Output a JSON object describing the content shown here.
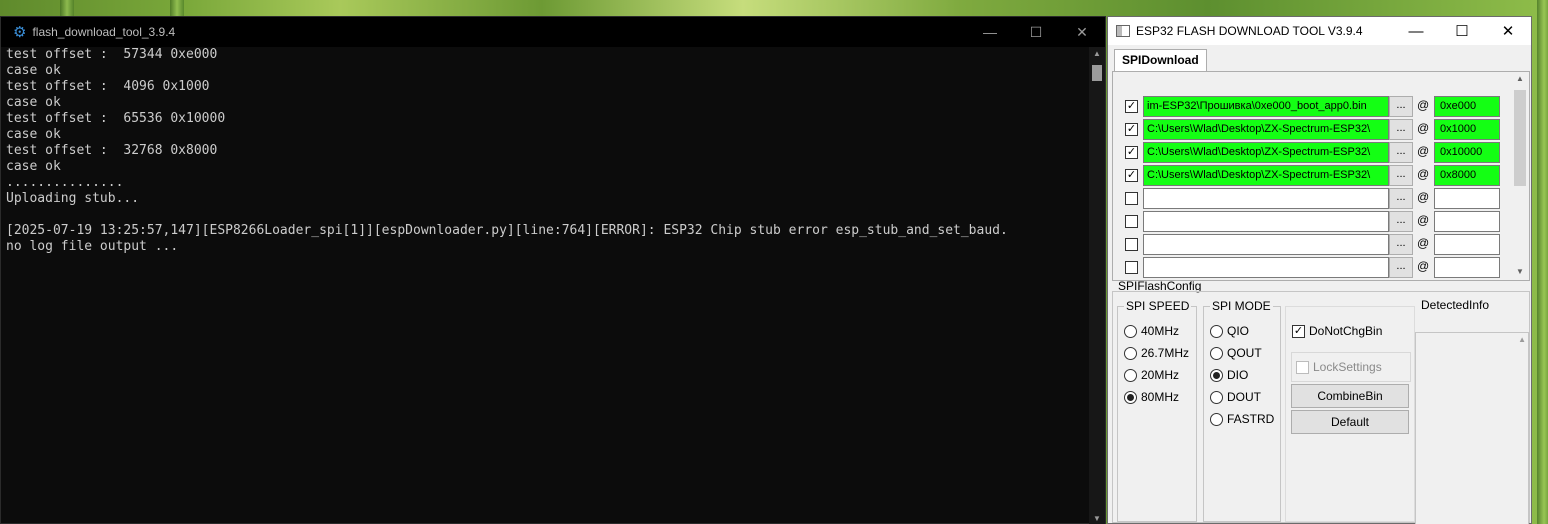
{
  "console": {
    "title": "flash_download_tool_3.9.4",
    "lines": [
      "test offset :  57344 0xe000",
      "case ok",
      "test offset :  4096 0x1000",
      "case ok",
      "test offset :  65536 0x10000",
      "case ok",
      "test offset :  32768 0x8000",
      "case ok",
      "...............",
      "Uploading stub...",
      "",
      "[2025-07-19 13:25:57,147][ESP8266Loader_spi[1]][espDownloader.py][line:764][ERROR]: ESP32 Chip stub error esp_stub_and_set_baud.",
      "no log file output ..."
    ]
  },
  "tool": {
    "title": "ESP32 FLASH DOWNLOAD TOOL V3.9.4",
    "tab": "SPIDownload",
    "browse_label": "...",
    "at_label": "@",
    "files": [
      {
        "checked": true,
        "path": "im-ESP32\\Прошивка\\0xe000_boot_app0.bin",
        "addr": "0xe000",
        "active": true
      },
      {
        "checked": true,
        "path": "C:\\Users\\Wlad\\Desktop\\ZX-Spectrum-ESP32\\",
        "addr": "0x1000",
        "active": true
      },
      {
        "checked": true,
        "path": "C:\\Users\\Wlad\\Desktop\\ZX-Spectrum-ESP32\\",
        "addr": "0x10000",
        "active": true
      },
      {
        "checked": true,
        "path": "C:\\Users\\Wlad\\Desktop\\ZX-Spectrum-ESP32\\",
        "addr": "0x8000",
        "active": true
      },
      {
        "checked": false,
        "path": "",
        "addr": "",
        "active": false
      },
      {
        "checked": false,
        "path": "",
        "addr": "",
        "active": false
      },
      {
        "checked": false,
        "path": "",
        "addr": "",
        "active": false
      },
      {
        "checked": false,
        "path": "",
        "addr": "",
        "active": false
      }
    ],
    "flash_config_label": "SPIFlashConfig",
    "spi_speed": {
      "label": "SPI SPEED",
      "options": [
        "40MHz",
        "26.7MHz",
        "20MHz",
        "80MHz"
      ],
      "selected": "80MHz"
    },
    "spi_mode": {
      "label": "SPI MODE",
      "options": [
        "QIO",
        "QOUT",
        "DIO",
        "DOUT",
        "FASTRD"
      ],
      "selected": "DIO"
    },
    "do_not_chg_bin": {
      "label": "DoNotChgBin",
      "checked": true
    },
    "lock_settings": {
      "label": "LockSettings",
      "checked": false
    },
    "combine_button": "CombineBin",
    "default_button": "Default",
    "detected_info_label": "DetectedInfo",
    "active_color": "#14ff14"
  }
}
